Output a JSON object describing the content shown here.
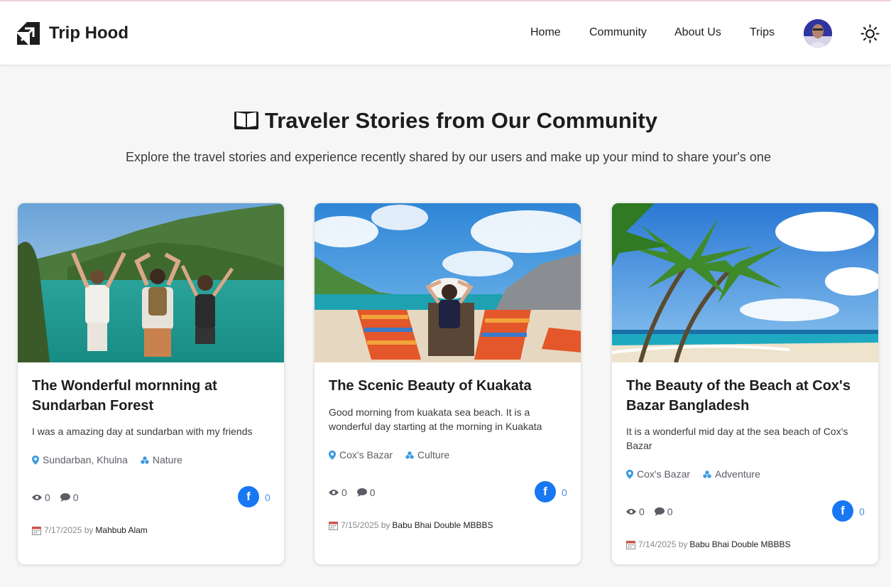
{
  "header": {
    "brand": "Trip Hood",
    "nav": [
      "Home",
      "Community",
      "About Us",
      "Trips"
    ]
  },
  "hero": {
    "title": "Traveler Stories from Our Community",
    "subtitle": "Explore the travel stories and experience recently shared by our users and make up your mind to share your's one"
  },
  "cards": [
    {
      "title": "The Wonderful mornning at Sundarban Forest",
      "description": "I was a amazing day at sundarban with my friends",
      "location": "Sundarban, Khulna",
      "category": "Nature",
      "views": "0",
      "comments": "0",
      "shares": "0",
      "date": "7/17/2025",
      "by": "by",
      "author": "Mahbub Alam"
    },
    {
      "title": "The Scenic Beauty of Kuakata",
      "description": "Good morning from kuakata sea beach. It is a wonderful day starting at the morning in Kuakata",
      "location": "Cox's Bazar",
      "category": "Culture",
      "views": "0",
      "comments": "0",
      "shares": "0",
      "date": "7/15/2025",
      "by": "by",
      "author": "Babu Bhai Double MBBBS"
    },
    {
      "title": "The Beauty of the Beach at Cox's Bazar Bangladesh",
      "description": "It is a wonderful mid day at the sea beach of Cox's Bazar",
      "location": "Cox's Bazar",
      "category": "Adventure",
      "views": "0",
      "comments": "0",
      "shares": "0",
      "date": "7/14/2025",
      "by": "by",
      "author": "Babu Bhai Double MBBBS"
    }
  ],
  "colors": {
    "accent_blue": "#3d9be0",
    "facebook_blue": "#1877f2",
    "page_background": "#f6f6f6"
  },
  "icons": {
    "logo": "trip-hood-logo",
    "theme": "sun-icon",
    "title": "book-icon",
    "location": "map-pin-icon",
    "category": "tag-cluster-icon",
    "views": "eye-icon",
    "comments": "comment-icon",
    "share": "facebook-icon",
    "date": "calendar-icon"
  }
}
